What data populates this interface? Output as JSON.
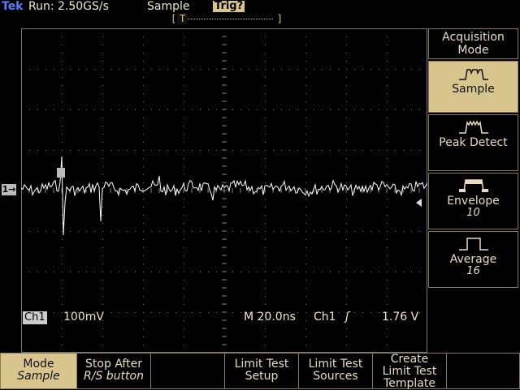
{
  "status": {
    "brand": "Tek",
    "run": "Run: 2.50GS/s",
    "mode": "Sample",
    "trig": "Trig?",
    "trig_marker": "T"
  },
  "channel_marker": "1→",
  "readouts": {
    "ch1_label": "Ch1",
    "ch1_scale": "100mV",
    "timebase": "M 20.0ns",
    "trig_source": "Ch1",
    "trig_slope": "ʃ",
    "trig_level": "1.76 V"
  },
  "side_menu": {
    "title_line1": "Acquisition",
    "title_line2": "Mode",
    "items": [
      {
        "label": "Sample",
        "sub": "",
        "icon": "sample-waveform-icon"
      },
      {
        "label": "Peak Detect",
        "sub": "",
        "icon": "peak-detect-waveform-icon"
      },
      {
        "label": "Envelope",
        "sub": "10",
        "icon": "envelope-waveform-icon"
      },
      {
        "label": "Average",
        "sub": "16",
        "icon": "average-waveform-icon"
      }
    ]
  },
  "bottom_menu": [
    {
      "line1": "Mode",
      "line2": "Sample"
    },
    {
      "line1": "Stop After",
      "line2": "R/S button"
    },
    {
      "line1": "",
      "line2": ""
    },
    {
      "line1": "Limit Test",
      "line2": "Setup"
    },
    {
      "line1": "Limit Test",
      "line2": "Sources"
    },
    {
      "line1": "Create",
      "line2": "Limit Test",
      "line3": "Template"
    }
  ],
  "colors": {
    "brand": "#5a7bff",
    "accent": "#d8c58e",
    "trace": "#ffffff",
    "background": "#000000"
  }
}
